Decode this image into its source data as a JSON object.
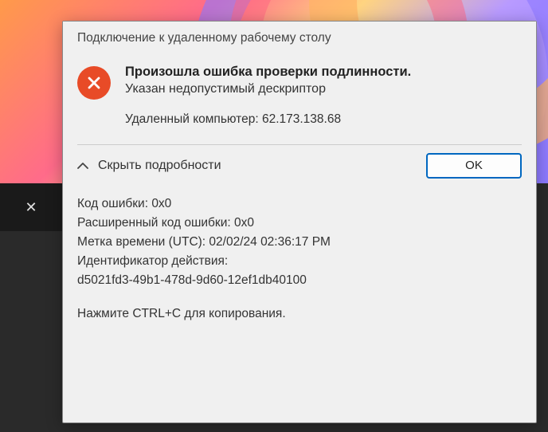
{
  "dialog": {
    "title": "Подключение к удаленному рабочему столу",
    "error_line1": "Произошла ошибка проверки подлинности.",
    "error_line2": "Указан недопустимый дескриптор",
    "remote_label": "Удаленный компьютер: ",
    "remote_value": "62.173.138.68",
    "toggle_label": "Скрыть подробности",
    "ok_label": "OK"
  },
  "details": {
    "error_code_label": "Код ошибки: ",
    "error_code_value": "0x0",
    "ext_error_code_label": "Расширенный код ошибки: ",
    "ext_error_code_value": "0x0",
    "timestamp_label": "Метка времени (UTC): ",
    "timestamp_value": "02/02/24 02:36:17 PM",
    "activity_id_label": "Идентификатор действия:",
    "activity_id_value": "d5021fd3-49b1-478d-9d60-12ef1db40100",
    "copy_hint": "Нажмите CTRL+C для копирования."
  },
  "icons": {
    "error": "error-circle-x",
    "chevron": "chevron-up",
    "close": "close-x"
  }
}
